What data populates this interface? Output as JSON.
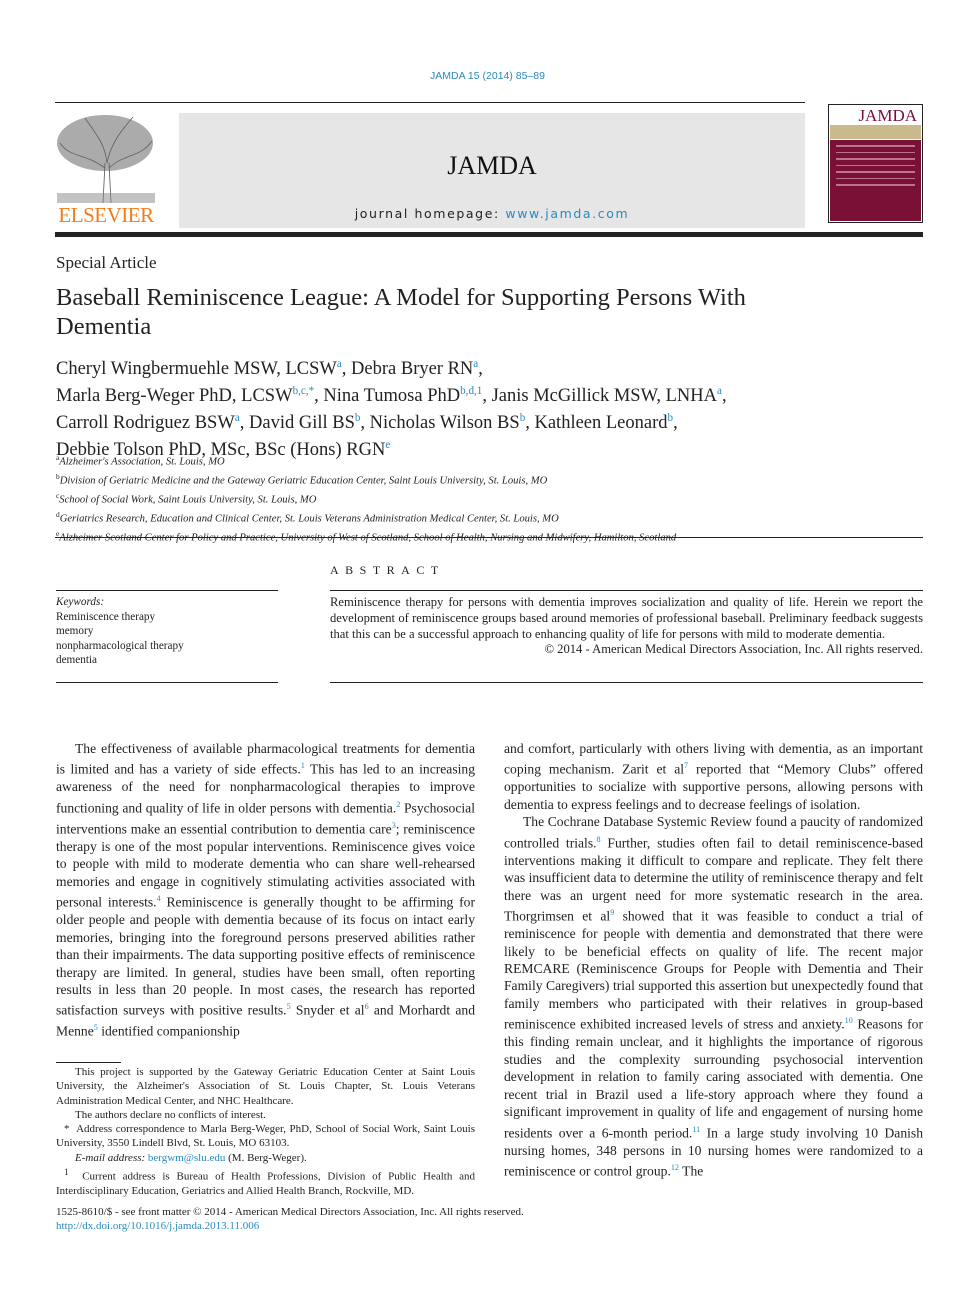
{
  "header": {
    "citation": "JAMDA 15 (2014) 85–89",
    "publisher_logo": "ELSEVIER",
    "journal_title": "JAMDA",
    "homepage_label": "journal homepage: ",
    "homepage_url": "www.jamda.com",
    "cover_title": "JAMDA",
    "cover_color": "#7a1036",
    "link_color": "#2a8ac0"
  },
  "article": {
    "section": "Special Article",
    "title": "Baseball Reminiscence League: A Model for Supporting Persons With Dementia",
    "author_lines": [
      [
        {
          "name": "Cheryl Wingbermuehle MSW, LCSW",
          "sup": "a",
          "sep": ", "
        },
        {
          "name": "Debra Bryer RN",
          "sup": "a",
          "sep": ","
        }
      ],
      [
        {
          "name": "Marla Berg-Weger PhD, LCSW",
          "sup": "b,c,*",
          "sep": ", "
        },
        {
          "name": "Nina Tumosa PhD",
          "sup": "b,d,1",
          "sep": ", "
        },
        {
          "name": "Janis McGillick MSW, LNHA",
          "sup": "a",
          "sep": ","
        }
      ],
      [
        {
          "name": "Carroll Rodriguez BSW",
          "sup": "a",
          "sep": ", "
        },
        {
          "name": "David Gill BS",
          "sup": "b",
          "sep": ", "
        },
        {
          "name": "Nicholas Wilson BS",
          "sup": "b",
          "sep": ", "
        },
        {
          "name": "Kathleen Leonard",
          "sup": "b",
          "sep": ","
        }
      ],
      [
        {
          "name": "Debbie Tolson PhD, MSc, BSc (Hons) RGN",
          "sup": "e",
          "sep": ""
        }
      ]
    ],
    "affiliations": [
      {
        "sup": "a",
        "text": "Alzheimer's Association, St. Louis, MO"
      },
      {
        "sup": "b",
        "text": "Division of Geriatric Medicine and the Gateway Geriatric Education Center, Saint Louis University, St. Louis, MO"
      },
      {
        "sup": "c",
        "text": "School of Social Work, Saint Louis University, St. Louis, MO"
      },
      {
        "sup": "d",
        "text": "Geriatrics Research, Education and Clinical Center, St. Louis Veterans Administration Medical Center, St. Louis, MO"
      },
      {
        "sup": "e",
        "text": "Alzheimer Scotland Center for Policy and Practice, University of West of Scotland, School of Health, Nursing and Midwifery, Hamilton, Scotland"
      }
    ]
  },
  "keywords": {
    "label": "Keywords:",
    "items": [
      "Reminiscence therapy",
      "memory",
      "nonpharmacological therapy",
      "dementia"
    ]
  },
  "abstract": {
    "heading": "ABSTRACT",
    "text": "Reminiscence therapy for persons with dementia improves socialization and quality of life. Herein we report the development of reminiscence groups based around memories of professional baseball. Preliminary feedback suggests that this can be a successful approach to enhancing quality of life for persons with mild to moderate dementia.",
    "copyright": "© 2014 - American Medical Directors Association, Inc. All rights reserved."
  },
  "body": {
    "left": [
      [
        {
          "t": "The effectiveness of available pharmacological treatments for dementia is limited and has a variety of side effects."
        },
        {
          "s": "1"
        },
        {
          "t": " This has led to an increasing awareness of the need for nonpharmacological therapies to improve functioning and quality of life in older persons with dementia."
        },
        {
          "s": "2"
        },
        {
          "t": " Psychosocial interventions make an essential contribution to dementia care"
        },
        {
          "s": "3"
        },
        {
          "t": "; reminiscence therapy is one of the most popular interventions. Reminiscence gives voice to people with mild to moderate dementia who can share well-rehearsed memories and engage in cognitively stimulating activities associated with personal interests."
        },
        {
          "s": "4"
        },
        {
          "t": " Reminiscence is generally thought to be affirming for older people and people with dementia because of its focus on intact early memories, bringing into the foreground persons preserved abilities rather than their impairments. The data supporting positive effects of reminiscence therapy are limited. In general, studies have been small, often reporting results in less than 20 people. In most cases, the research has reported satisfaction surveys with positive results."
        },
        {
          "s": "5"
        },
        {
          "t": " Snyder et al"
        },
        {
          "s": "6"
        },
        {
          "t": " and Morhardt and Menne"
        },
        {
          "s": "5"
        },
        {
          "t": " identified companionship"
        }
      ]
    ],
    "right": [
      [
        {
          "t": "and comfort, particularly with others living with dementia, as an important coping mechanism. Zarit et al"
        },
        {
          "s": "7"
        },
        {
          "t": " reported that “Memory Clubs” offered opportunities to socialize with supportive persons, allowing persons with dementia to express feelings and to decrease feelings of isolation."
        }
      ],
      [
        {
          "t": "The Cochrane Database Systemic Review found a paucity of randomized controlled trials."
        },
        {
          "s": "8"
        },
        {
          "t": " Further, studies often fail to detail reminiscence-based interventions making it difficult to compare and replicate. They felt there was insufficient data to determine the utility of reminiscence therapy and felt there was an urgent need for more systematic research in the area. Thorgrimsen et al"
        },
        {
          "s": "9"
        },
        {
          "t": " showed that it was feasible to conduct a trial of reminiscence for people with dementia and demonstrated that there were likely to be beneficial effects on quality of life. The recent major REMCARE (Reminiscence Groups for People with Dementia and Their Family Caregivers) trial supported this assertion but unexpectedly found that family members who participated with their relatives in group-based reminiscence exhibited increased levels of stress and anxiety."
        },
        {
          "s": "10"
        },
        {
          "t": " Reasons for this finding remain unclear, and it highlights the importance of rigorous studies and the complexity surrounding psychosocial intervention development in relation to family caring associated with dementia. One recent trial in Brazil used a life-story approach where they found a significant improvement in quality of life and engagement of nursing home residents over a 6-month period."
        },
        {
          "s": "11"
        },
        {
          "t": " In a large study involving 10 Danish nursing homes, 348 persons in 10 nursing homes were randomized to a reminiscence or control group."
        },
        {
          "s": "12"
        },
        {
          "t": " The"
        }
      ]
    ]
  },
  "footnotes": {
    "funding": "This project is supported by the Gateway Geriatric Education Center at Saint Louis University, the Alzheimer's Association of St. Louis Chapter, St. Louis Veterans Administration Medical Center, and NHC Healthcare.",
    "conflicts": "The authors declare no conflicts of interest.",
    "correspondence_mark": "*",
    "correspondence": "Address correspondence to Marla Berg-Weger, PhD, School of Social Work, Saint Louis University, 3550 Lindell Blvd, St. Louis, MO 63103.",
    "email_label": "E-mail address:",
    "email": "bergwm@slu.edu",
    "email_owner": " (M. Berg-Weger).",
    "address_mark": "1",
    "current_address": "Current address is Bureau of Health Professions, Division of Public Health and Interdisciplinary Education, Geriatrics and Allied Health Branch, Rockville, MD."
  },
  "front_matter": {
    "issn": "1525-8610/$ - see front matter © 2014 - American Medical Directors Association, Inc. All rights reserved.",
    "doi": "http://dx.doi.org/10.1016/j.jamda.2013.11.006"
  }
}
